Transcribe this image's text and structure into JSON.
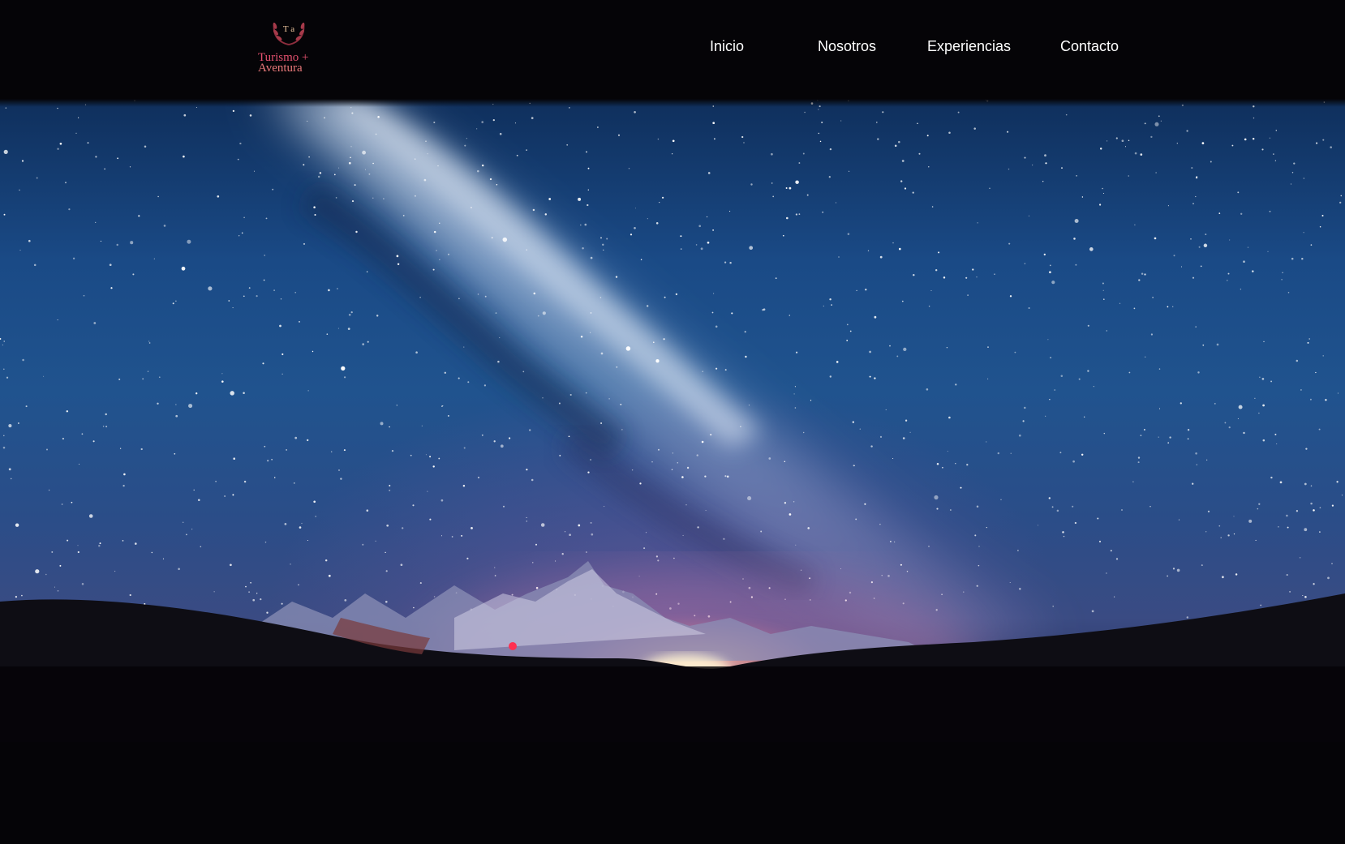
{
  "header": {
    "logo": {
      "monogram": "T a",
      "line1": "Turismo +",
      "line2": "Aventura"
    },
    "nav": [
      {
        "label": "Inicio"
      },
      {
        "label": "Nosotros"
      },
      {
        "label": "Experiencias"
      },
      {
        "label": "Contacto"
      }
    ]
  },
  "hero": {
    "image": "night-sky-milky-way-mountains"
  },
  "colors": {
    "background": "#050407",
    "nav_text": "#ffffff",
    "logo_accent": "#e2506e"
  }
}
